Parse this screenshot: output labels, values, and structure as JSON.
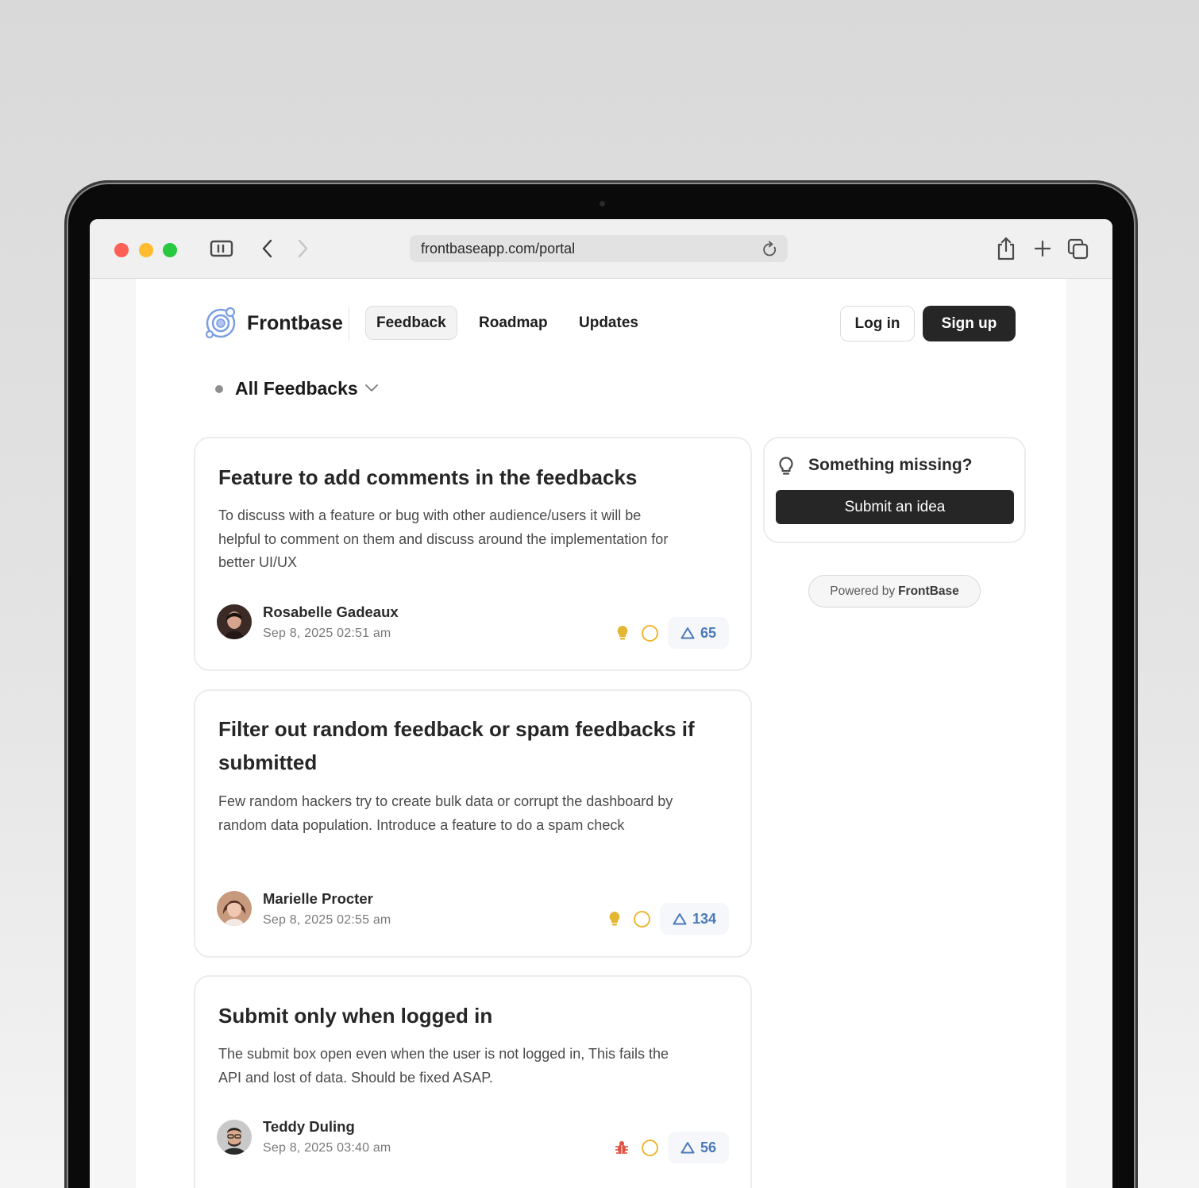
{
  "browser": {
    "url": "frontbaseapp.com/portal"
  },
  "nav": {
    "brand": "Frontbase",
    "links": [
      "Feedback",
      "Roadmap",
      "Updates"
    ],
    "login": "Log in",
    "signup": "Sign up"
  },
  "filter": {
    "label": "All Feedbacks"
  },
  "feedbacks": [
    {
      "title": "Feature to add comments in the feedbacks",
      "description": "To discuss with a feature or bug with other audience/users it will be helpful to comment on them and discuss around the implementation for better UI/UX",
      "author": "Rosabelle Gadeaux",
      "date": "Sep 8, 2025 02:51 am",
      "type_icon": "bulb-icon",
      "votes": "65"
    },
    {
      "title": "Filter out random feedback or spam feedbacks if submitted",
      "description": "Few random hackers try to create bulk data or corrupt the dashboard by random data population. Introduce a feature to do a spam check",
      "author": "Marielle Procter",
      "date": "Sep 8, 2025 02:55 am",
      "type_icon": "bulb-icon",
      "votes": "134"
    },
    {
      "title": "Submit only when logged in",
      "description": "The submit box open even when the user is not logged in, This fails the API and lost of data. Should be fixed ASAP.",
      "author": "Teddy Duling",
      "date": "Sep 8, 2025 03:40 am",
      "type_icon": "bug-icon",
      "votes": "56"
    }
  ],
  "sidebar": {
    "title": "Something missing?",
    "submit": "Submit an idea",
    "powered_prefix": "Powered by",
    "powered_brand": "FrontBase"
  },
  "colors": {
    "accent_dark": "#262626",
    "vote_blue": "#4b7ab8",
    "status_yellow": "#efb631",
    "bug_red": "#e2513f"
  }
}
